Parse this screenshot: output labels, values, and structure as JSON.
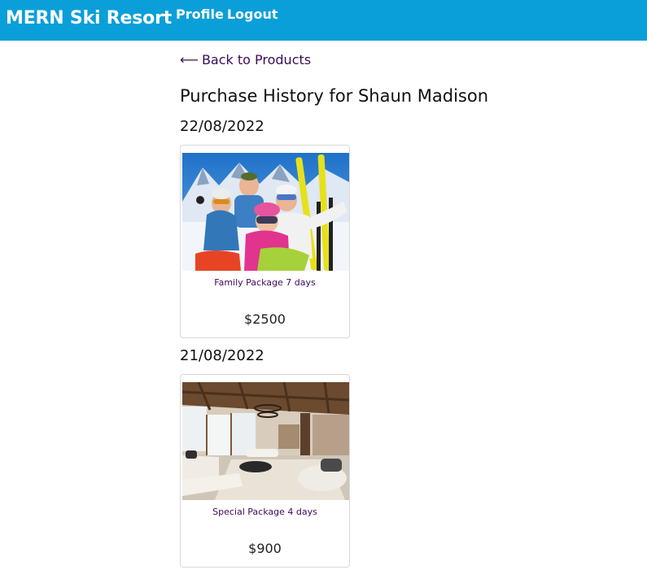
{
  "header": {
    "brand": "MERN Ski Resort",
    "nav": [
      {
        "label": "Profile"
      },
      {
        "label": "Logout"
      }
    ],
    "background_color": "#0a9fd9"
  },
  "main": {
    "back_link": {
      "arrow": "⟵",
      "label": "Back to Products",
      "icon": "arrow-left-icon"
    },
    "title": "Purchase History for Shaun Madison",
    "purchases": [
      {
        "date": "22/08/2022",
        "product": {
          "name": "Family Package 7 days",
          "price": "$2500",
          "image": "family-skiers-photo"
        }
      },
      {
        "date": "21/08/2022",
        "product": {
          "name": "Special Package 4 days",
          "price": "$900",
          "image": "chalet-interior-photo"
        }
      }
    ]
  },
  "colors": {
    "accent": "#0a9fd9",
    "link": "#3b0a57",
    "text": "#111111"
  }
}
